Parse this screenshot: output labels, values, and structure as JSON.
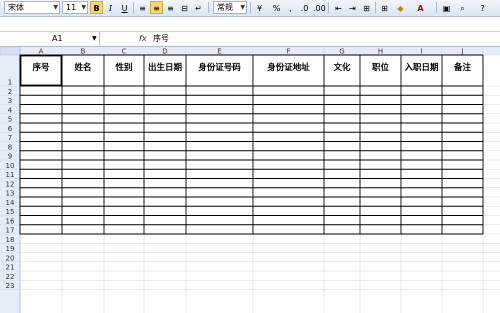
{
  "toolbar": {
    "font_name": "宋体",
    "font_size": "11",
    "bold_icon": "B",
    "italic_icon": "I",
    "underline_icon": "U",
    "number_format": "常规",
    "percent_icon": "%",
    "comma_icon": ","
  },
  "formula_bar": {
    "cell_ref": "A1",
    "fx_label": "fx",
    "value": "序号"
  },
  "columns": [
    "A",
    "B",
    "C",
    "D",
    "E",
    "F",
    "G",
    "H",
    "I",
    "J"
  ],
  "headers": [
    "序号",
    "姓名",
    "性别",
    "出生日期",
    "身份证号码",
    "身份证地址",
    "文化",
    "职位",
    "入职日期",
    "备注"
  ],
  "row_numbers": [
    "1",
    "2",
    "3",
    "4",
    "5",
    "6",
    "7",
    "8",
    "9",
    "10",
    "11",
    "12",
    "13",
    "14",
    "15",
    "16",
    "17",
    "18",
    "19",
    "20",
    "21",
    "22",
    "23"
  ],
  "colors": {
    "toolbar_bg": "#dbe5f1",
    "header_bg": "#e4ecf7",
    "grid": "#d0d7e5",
    "border": "#000000"
  }
}
